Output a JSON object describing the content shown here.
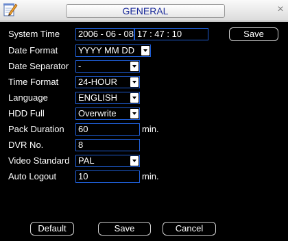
{
  "window": {
    "title": "GENERAL",
    "close_glyph": "×"
  },
  "settings": {
    "system_time": {
      "label": "System Time",
      "date": "2006 - 06 - 08",
      "time": "17 : 47 : 10",
      "save_label": "Save"
    },
    "date_format": {
      "label": "Date Format",
      "value": "YYYY MM DD"
    },
    "date_separator": {
      "label": "Date Separator",
      "value": "-"
    },
    "time_format": {
      "label": "Time Format",
      "value": "24-HOUR"
    },
    "language": {
      "label": "Language",
      "value": "ENGLISH"
    },
    "hdd_full": {
      "label": "HDD Full",
      "value": "Overwrite"
    },
    "pack_duration": {
      "label": "Pack Duration",
      "value": "60",
      "unit": "min."
    },
    "dvr_no": {
      "label": "DVR No.",
      "value": "8"
    },
    "video_standard": {
      "label": "Video Standard",
      "value": "PAL"
    },
    "auto_logout": {
      "label": "Auto Logout",
      "value": "10",
      "unit": "min."
    }
  },
  "footer": {
    "default_label": "Default",
    "save_label": "Save",
    "cancel_label": "Cancel"
  },
  "colors": {
    "background": "#000000",
    "field_border": "#1f5ed6",
    "title_text": "#1a2a9a",
    "text": "#ffffff"
  },
  "icons": {
    "app": "notepad-pencil-icon",
    "close": "close-icon",
    "dropdown": "dropdown-arrow-icon"
  }
}
